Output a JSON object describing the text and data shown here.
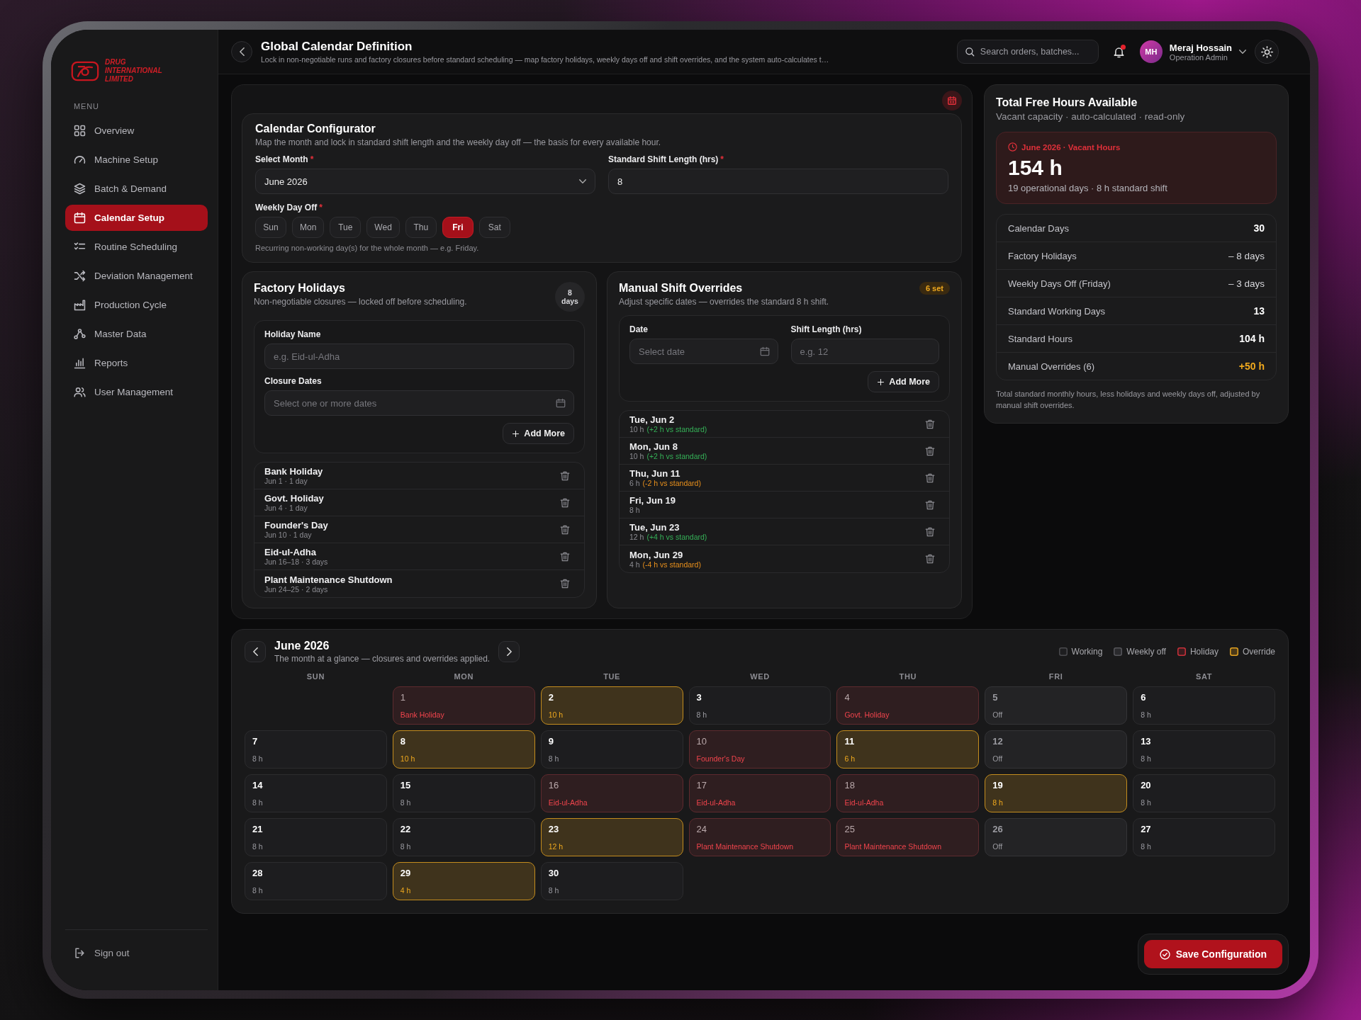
{
  "sidebar": {
    "brand": "DRUG INTERNATIONAL LIMITED",
    "menu_heading": "MENU",
    "items": [
      {
        "label": "Overview",
        "selected": false
      },
      {
        "label": "Machine Setup",
        "selected": false
      },
      {
        "label": "Batch & Demand",
        "selected": false
      },
      {
        "label": "Calendar Setup",
        "selected": true
      },
      {
        "label": "Routine Scheduling",
        "selected": false
      },
      {
        "label": "Deviation Management",
        "selected": false
      },
      {
        "label": "Production Cycle",
        "selected": false
      },
      {
        "label": "Master Data",
        "selected": false
      },
      {
        "label": "Reports",
        "selected": false
      },
      {
        "label": "User Management",
        "selected": false
      }
    ],
    "sign_out": "Sign out"
  },
  "header": {
    "title": "Global Calendar Definition",
    "subtitle": "Lock in non-negotiable runs and factory closures before standard scheduling — map factory holidays, weekly days off and shift overrides, and the system auto-calculates t…",
    "search": {
      "placeholder": "Search orders, batches..."
    },
    "notifications": {
      "unread": true
    },
    "user": {
      "initials": "MH",
      "name": "Meraj Hossain",
      "role": "Operation Admin"
    }
  },
  "configurator": {
    "title": "Calendar Configurator",
    "subtitle": "Map the month and lock in standard shift length and the weekly day off — the basis for every available hour.",
    "month_field": {
      "label": "Select Month",
      "required_mark": "*",
      "value": "June 2026"
    },
    "shift_field": {
      "label": "Standard Shift Length (hrs)",
      "required_mark": "*",
      "value": "8"
    },
    "weekly_day_off": {
      "label": "Weekly Day Off",
      "required_mark": "*",
      "days": [
        {
          "label": "Sun",
          "selected": false
        },
        {
          "label": "Mon",
          "selected": false
        },
        {
          "label": "Tue",
          "selected": false
        },
        {
          "label": "Wed",
          "selected": false
        },
        {
          "label": "Thu",
          "selected": false
        },
        {
          "label": "Fri",
          "selected": true
        },
        {
          "label": "Sat",
          "selected": false
        }
      ],
      "hint": "Recurring non-working day(s) for the whole month — e.g. Friday."
    }
  },
  "factory_holidays": {
    "title": "Factory Holidays",
    "subtitle": "Non-negotiable closures — locked off before scheduling.",
    "badge": "8 days",
    "name_field": {
      "label": "Holiday Name",
      "placeholder": "e.g. Eid-ul-Adha"
    },
    "dates_field": {
      "label": "Closure Dates",
      "placeholder": "Select one or more dates"
    },
    "add_button": "Add More",
    "items": [
      {
        "name": "Bank Holiday",
        "detail": "Jun 1 · 1 day"
      },
      {
        "name": "Govt. Holiday",
        "detail": "Jun 4 · 1 day"
      },
      {
        "name": "Founder's Day",
        "detail": "Jun 10 · 1 day"
      },
      {
        "name": "Eid-ul-Adha",
        "detail": "Jun 16–18 · 3 days"
      },
      {
        "name": "Plant Maintenance Shutdown",
        "detail": "Jun 24–25 · 2 days"
      }
    ]
  },
  "shift_overrides": {
    "title": "Manual Shift Overrides",
    "subtitle": "Adjust specific dates — overrides the standard 8 h shift.",
    "badge": "6 set",
    "date_field": {
      "label": "Date",
      "placeholder": "Select date"
    },
    "length_field": {
      "label": "Shift Length (hrs)",
      "placeholder": "e.g. 12"
    },
    "add_button": "Add More",
    "items": [
      {
        "date": "Tue, Jun 2",
        "hours": "10 h",
        "delta": "(+2 h vs standard)",
        "above_standard": true
      },
      {
        "date": "Mon, Jun 8",
        "hours": "10 h",
        "delta": "(+2 h vs standard)",
        "above_standard": true
      },
      {
        "date": "Thu, Jun 11",
        "hours": "6 h",
        "delta": "(-2 h vs standard)",
        "above_standard": false
      },
      {
        "date": "Fri, Jun 19",
        "hours": "8 h"
      },
      {
        "date": "Tue, Jun 23",
        "hours": "12 h",
        "delta": "(+4 h vs standard)",
        "above_standard": true
      },
      {
        "date": "Mon, Jun 29",
        "hours": "4 h",
        "delta": "(-4 h vs standard)",
        "above_standard": false
      }
    ]
  },
  "free_hours": {
    "title": "Total Free Hours Available",
    "subtitle": "Vacant capacity · auto-calculated · read-only",
    "highlight": {
      "caption": "June 2026 · Vacant Hours",
      "value": "154 h",
      "detail": "19 operational days · 8 h standard shift"
    },
    "rows": [
      {
        "label": "Calendar Days",
        "value": "30",
        "kind": "total"
      },
      {
        "label": "Factory Holidays",
        "value": "– 8 days",
        "kind": "deduction"
      },
      {
        "label": "Weekly Days Off (Friday)",
        "value": "– 3 days",
        "kind": "deduction"
      },
      {
        "label": "Standard Working Days",
        "value": "13",
        "kind": "total"
      },
      {
        "label": "Standard Hours",
        "value": "104 h",
        "kind": "total"
      },
      {
        "label": "Manual Overrides (6)",
        "value": "+50 h",
        "kind": "adjustment"
      }
    ],
    "footnote": "Total standard monthly hours, less holidays and weekly days off, adjusted by manual shift overrides."
  },
  "calendar": {
    "title": "June 2026",
    "subtitle": "The month at a glance — closures and overrides applied.",
    "legend": [
      {
        "label": "Working",
        "kind": "working"
      },
      {
        "label": "Weekly off",
        "kind": "off"
      },
      {
        "label": "Holiday",
        "kind": "holiday"
      },
      {
        "label": "Override",
        "kind": "override"
      }
    ],
    "weekdays": [
      "SUN",
      "MON",
      "TUE",
      "WED",
      "THU",
      "FRI",
      "SAT"
    ],
    "weeks": [
      [
        {
          "day": "1",
          "kind": "holiday",
          "detail": "Bank Holiday"
        },
        {
          "day": "2",
          "kind": "override",
          "detail": "10 h"
        },
        {
          "day": "3",
          "kind": "working",
          "detail": "8 h"
        },
        {
          "day": "4",
          "kind": "holiday",
          "detail": "Govt. Holiday"
        },
        {
          "day": "5",
          "kind": "off",
          "detail": "Off"
        },
        {
          "day": "6",
          "kind": "working",
          "detail": "8 h"
        }
      ],
      [
        {
          "day": "7",
          "kind": "working",
          "detail": "8 h"
        },
        {
          "day": "8",
          "kind": "override",
          "detail": "10 h"
        },
        {
          "day": "9",
          "kind": "working",
          "detail": "8 h"
        },
        {
          "day": "10",
          "kind": "holiday",
          "detail": "Founder's Day"
        },
        {
          "day": "11",
          "kind": "override",
          "detail": "6 h"
        },
        {
          "day": "12",
          "kind": "off",
          "detail": "Off"
        },
        {
          "day": "13",
          "kind": "working",
          "detail": "8 h"
        }
      ],
      [
        {
          "day": "14",
          "kind": "working",
          "detail": "8 h"
        },
        {
          "day": "15",
          "kind": "working",
          "detail": "8 h"
        },
        {
          "day": "16",
          "kind": "holiday",
          "detail": "Eid-ul-Adha"
        },
        {
          "day": "17",
          "kind": "holiday",
          "detail": "Eid-ul-Adha"
        },
        {
          "day": "18",
          "kind": "holiday",
          "detail": "Eid-ul-Adha"
        },
        {
          "day": "19",
          "kind": "override",
          "detail": "8 h"
        },
        {
          "day": "20",
          "kind": "working",
          "detail": "8 h"
        }
      ],
      [
        {
          "day": "21",
          "kind": "working",
          "detail": "8 h"
        },
        {
          "day": "22",
          "kind": "working",
          "detail": "8 h"
        },
        {
          "day": "23",
          "kind": "override",
          "detail": "12 h"
        },
        {
          "day": "24",
          "kind": "holiday",
          "detail": "Plant Maintenance Shutdown"
        },
        {
          "day": "25",
          "kind": "holiday",
          "detail": "Plant Maintenance Shutdown"
        },
        {
          "day": "26",
          "kind": "off",
          "detail": "Off"
        },
        {
          "day": "27",
          "kind": "working",
          "detail": "8 h"
        }
      ],
      [
        {
          "day": "28",
          "kind": "working",
          "detail": "8 h"
        },
        {
          "day": "29",
          "kind": "override",
          "detail": "4 h"
        },
        {
          "day": "30",
          "kind": "working",
          "detail": "8 h"
        }
      ]
    ]
  },
  "save_button": "Save Configuration"
}
